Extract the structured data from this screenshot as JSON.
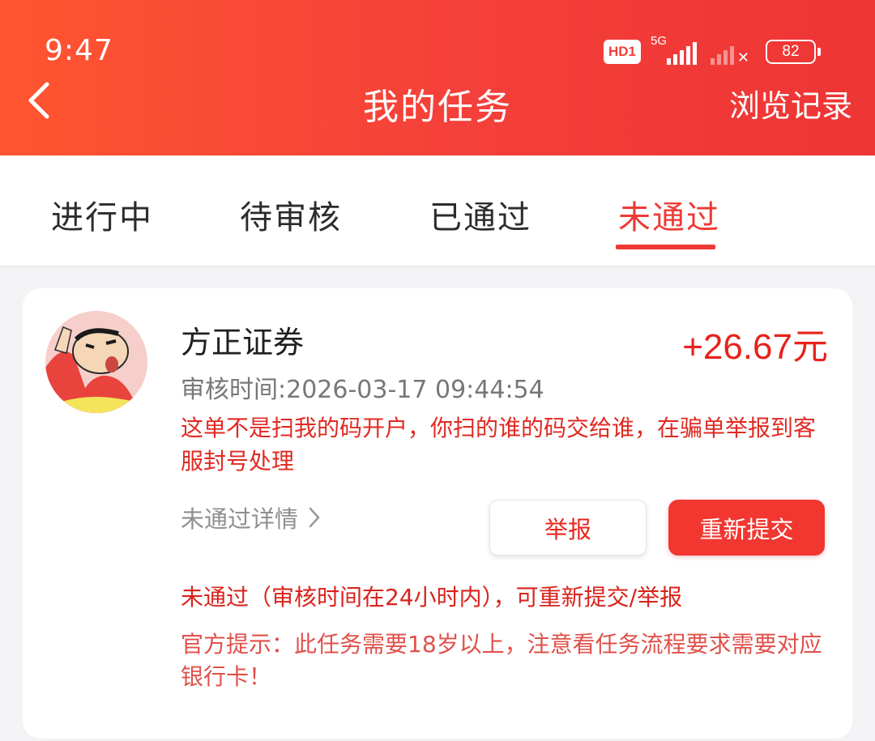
{
  "status_bar": {
    "time": "9:47",
    "hd_label": "HD1",
    "network": "5G",
    "battery": "82"
  },
  "header": {
    "title": "我的任务",
    "back_icon": "chevron-left-icon",
    "history_label": "浏览记录"
  },
  "tabs": [
    {
      "label": "进行中",
      "active": false
    },
    {
      "label": "待审核",
      "active": false
    },
    {
      "label": "已通过",
      "active": false
    },
    {
      "label": "未通过",
      "active": true
    }
  ],
  "task": {
    "name": "方正证券",
    "reward": "+26.67元",
    "review_time": "审核时间:2026-03-17 09:44:54",
    "reason": "这单不是扫我的码开户，你扫的谁的码交给谁，在骗单举报到客服封号处理",
    "detail_link": "未通过详情",
    "report_button": "举报",
    "resubmit_button": "重新提交",
    "fail_note": "未通过（审核时间在24小时内），可重新提交/举报",
    "official_tip": "官方提示：此任务需要18岁以上，注意看任务流程要求需要对应银行卡！"
  },
  "colors": {
    "header_start": "#ff5530",
    "header_end": "#ee3535",
    "accent_red": "#ee3a35",
    "reward_red": "#e8221c"
  }
}
